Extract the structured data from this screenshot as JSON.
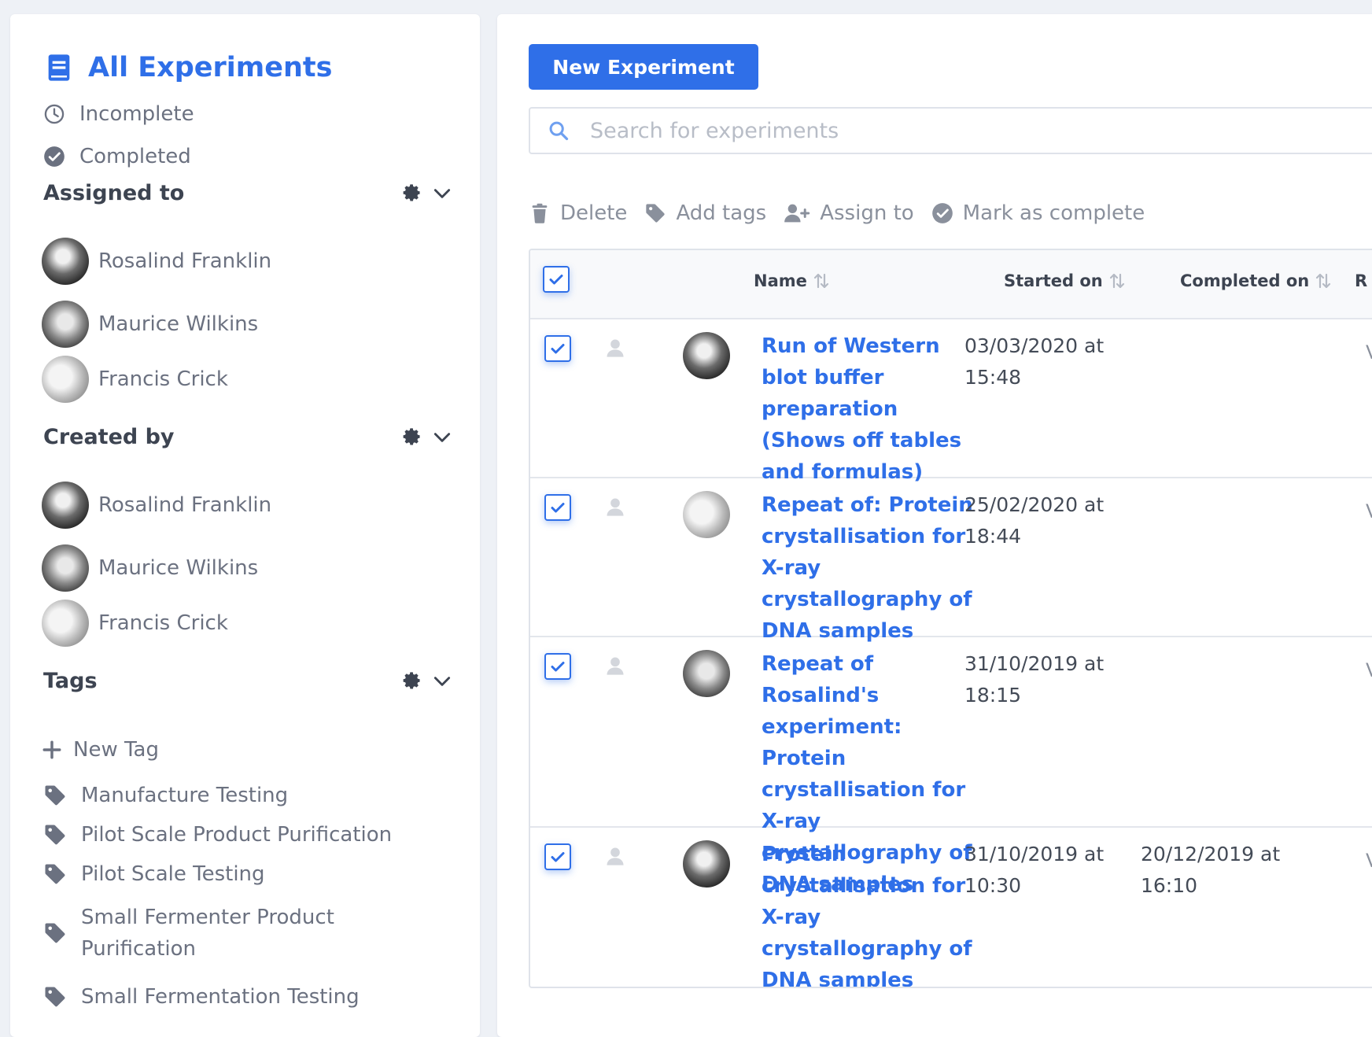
{
  "sidebar": {
    "title": "All Experiments",
    "filters": [
      {
        "label": "Incomplete"
      },
      {
        "label": "Completed"
      }
    ],
    "assigned_to": {
      "heading": "Assigned to",
      "people": [
        {
          "name": "Rosalind Franklin"
        },
        {
          "name": "Maurice Wilkins"
        },
        {
          "name": "Francis Crick"
        }
      ]
    },
    "created_by": {
      "heading": "Created by",
      "people": [
        {
          "name": "Rosalind Franklin"
        },
        {
          "name": "Maurice Wilkins"
        },
        {
          "name": "Francis Crick"
        }
      ]
    },
    "tags": {
      "heading": "Tags",
      "new_tag": "New Tag",
      "items": [
        {
          "label": "Manufacture Testing"
        },
        {
          "label": "Pilot Scale Product Purification"
        },
        {
          "label": "Pilot Scale Testing"
        },
        {
          "label": "Small Fermenter Product Purification"
        },
        {
          "label": "Small Fermentation Testing"
        }
      ]
    }
  },
  "main": {
    "new_button": "New Experiment",
    "search": {
      "placeholder": "Search for experiments",
      "value": ""
    },
    "actions": {
      "delete": "Delete",
      "add_tags": "Add tags",
      "assign_to": "Assign to",
      "mark_complete": "Mark as complete"
    },
    "table": {
      "columns": {
        "name": "Name",
        "started_on": "Started on",
        "completed_on": "Completed on",
        "partial": "R"
      },
      "rows": [
        {
          "name": "Run of Western blot buffer preparation (Shows off tables and formulas)",
          "started": "03/03/2020 at 15:48",
          "completed": "",
          "link": "V ("
        },
        {
          "name": "Repeat of: Protein crystallisation for X-ray crystallography of DNA samples",
          "started": "25/02/2020 at 18:44",
          "completed": "",
          "link": "V ("
        },
        {
          "name": "Repeat of Rosalind's experiment: Protein crystallisation for X-ray crystallography of DNA samples",
          "started": "31/10/2019 at 18:15",
          "completed": "",
          "link": "V ("
        },
        {
          "name": "Protein crystallisation for X-ray crystallography of DNA samples",
          "started": "31/10/2019 at 10:30",
          "completed": "20/12/2019 at 16:10",
          "link": "V ("
        }
      ]
    }
  },
  "colors": {
    "accent": "#2f6fe8",
    "muted": "#6b7180",
    "heading": "#3d4451"
  }
}
